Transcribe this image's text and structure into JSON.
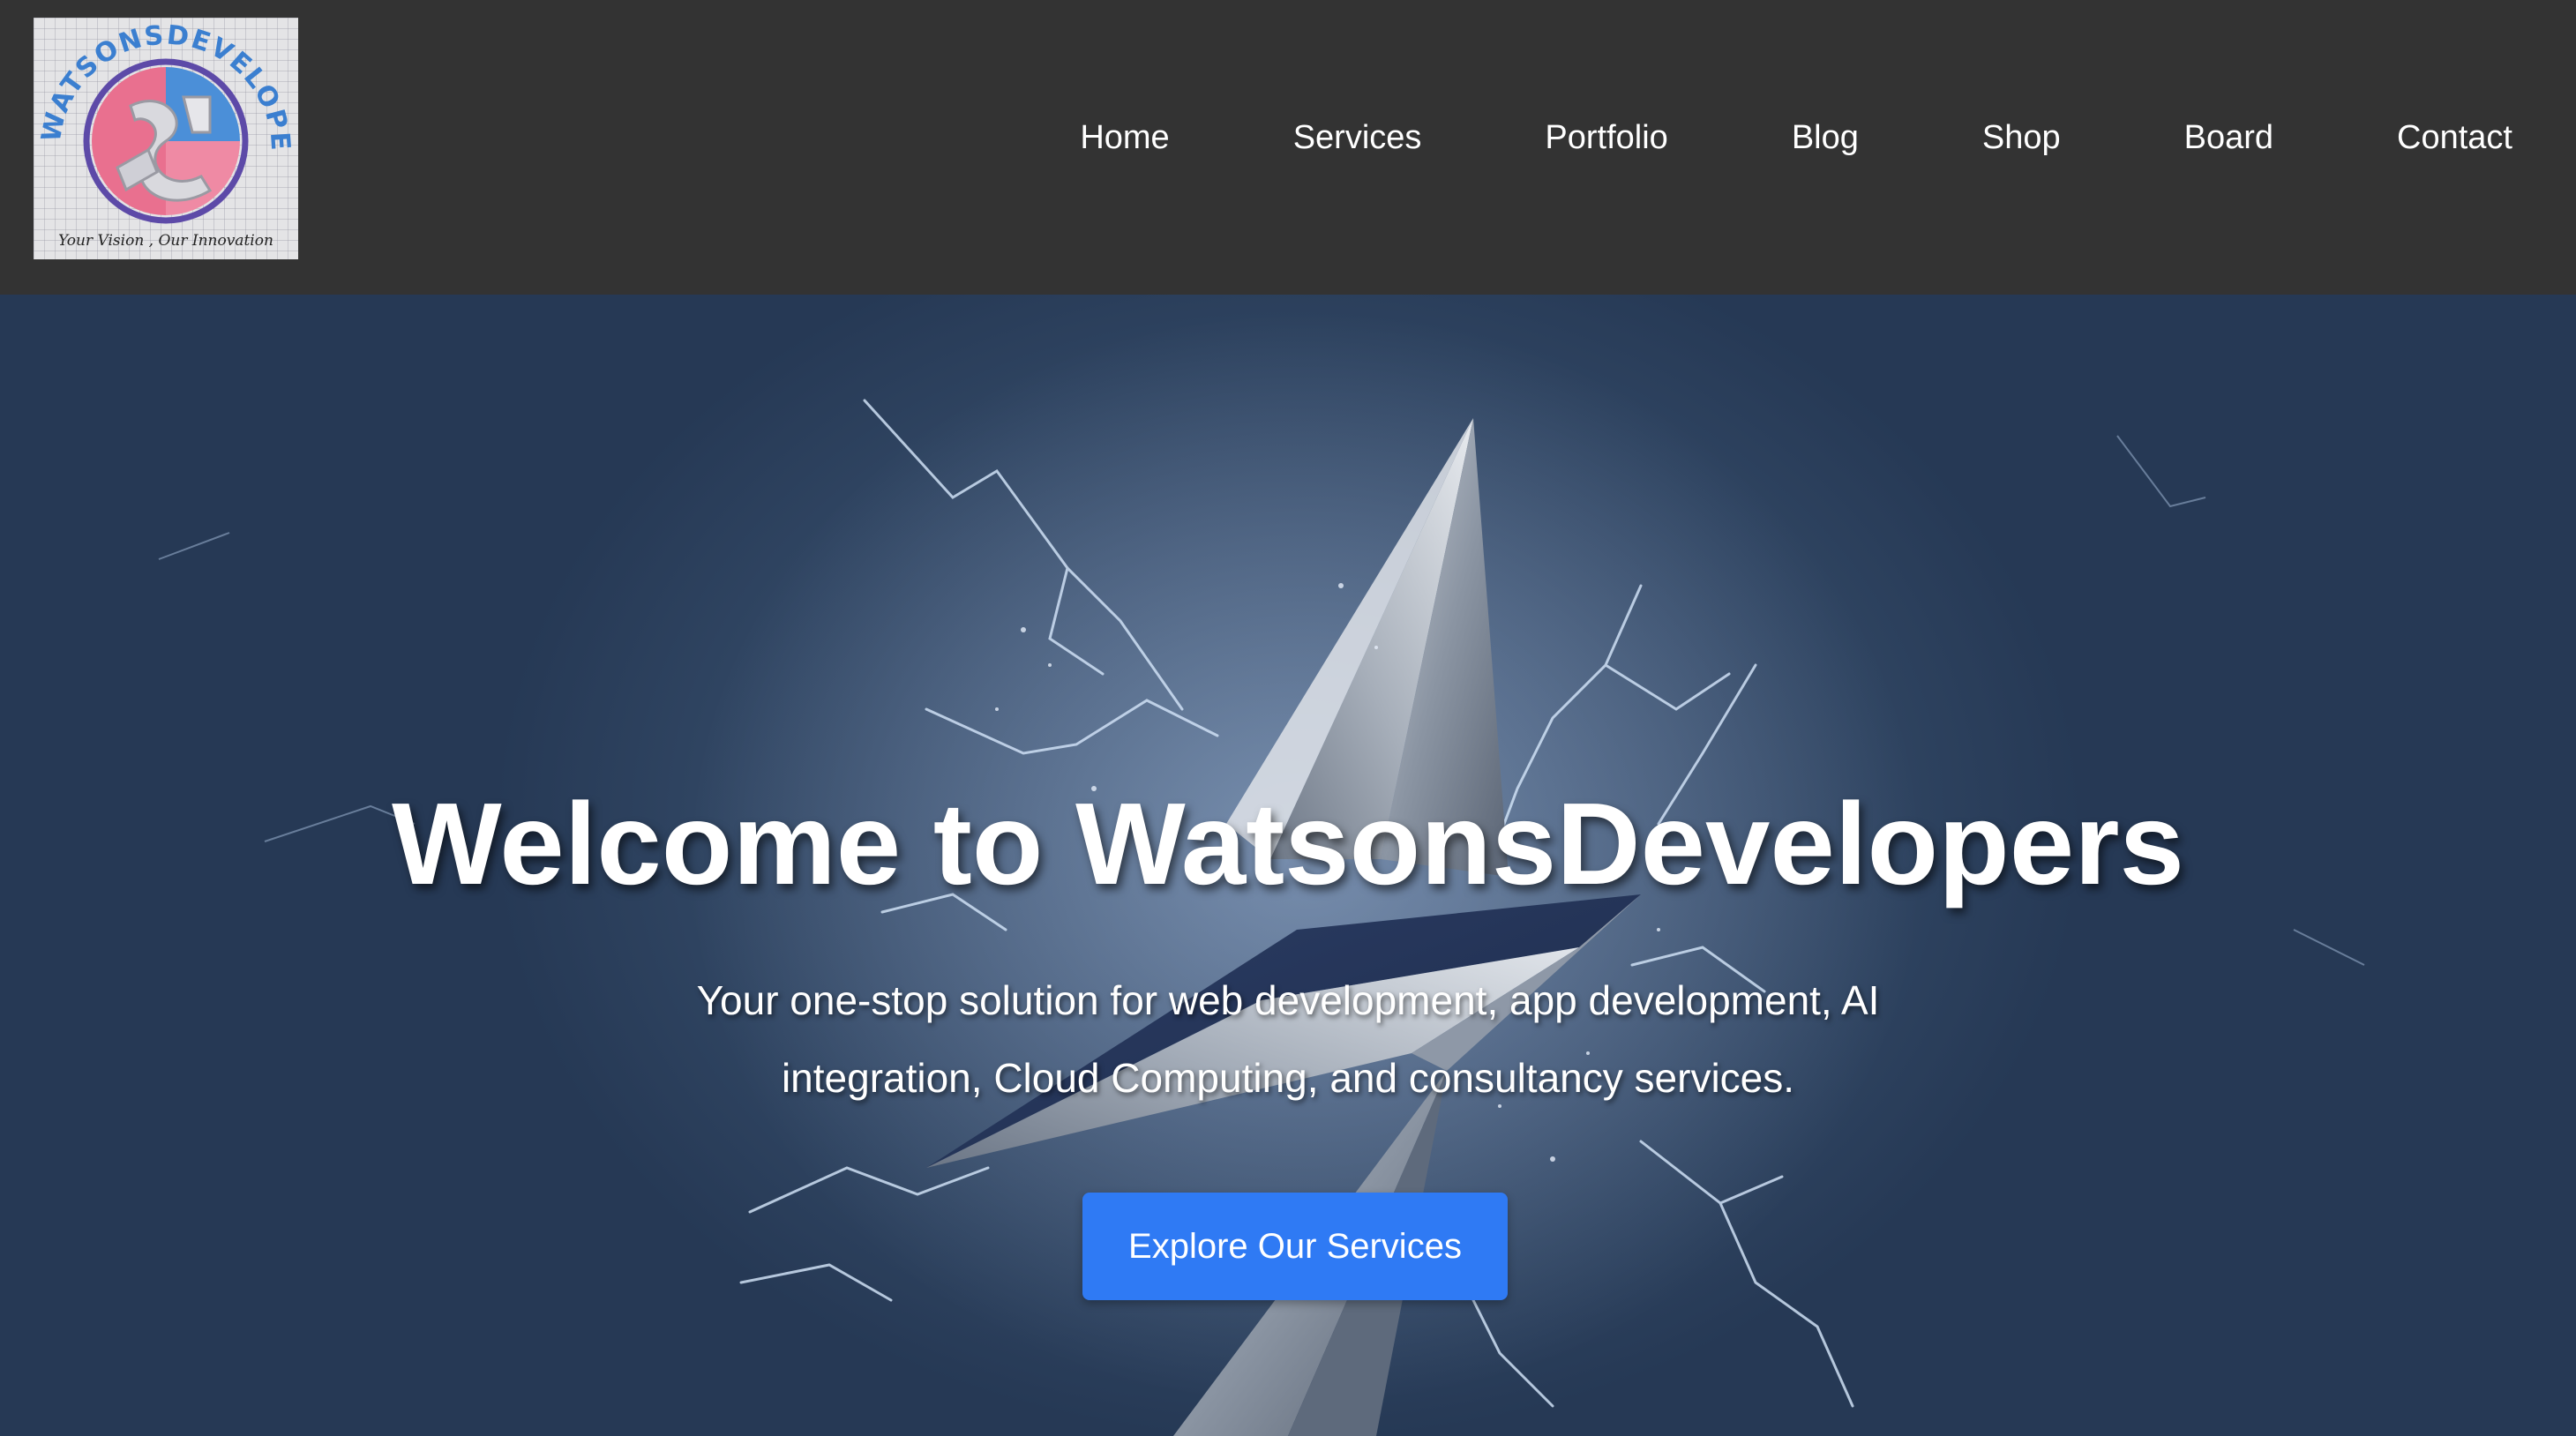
{
  "logo": {
    "brand_text": "WATSONSDEVELOPERS",
    "tagline": "Your Vision , Our Innovation",
    "icon": "watsonsdevelopers-logo-icon"
  },
  "nav": {
    "items": [
      {
        "label": "Home"
      },
      {
        "label": "Services"
      },
      {
        "label": "Portfolio"
      },
      {
        "label": "Blog"
      },
      {
        "label": "Shop"
      },
      {
        "label": "Board"
      },
      {
        "label": "Contact"
      }
    ]
  },
  "hero": {
    "title": "Welcome to WatsonsDevelopers",
    "subtitle": "Your one-stop solution for web development, app development, AI integration, Cloud Computing, and consultancy services.",
    "cta_label": "Explore Our Services",
    "background_icon": "lightning-bolt-icon"
  },
  "colors": {
    "header_bg": "#333333",
    "nav_text": "#ffffff",
    "hero_bg": "#3c5270",
    "cta_bg": "#2f7af4",
    "logo_pink": "#e9708f",
    "logo_blue": "#3b7fd0"
  }
}
